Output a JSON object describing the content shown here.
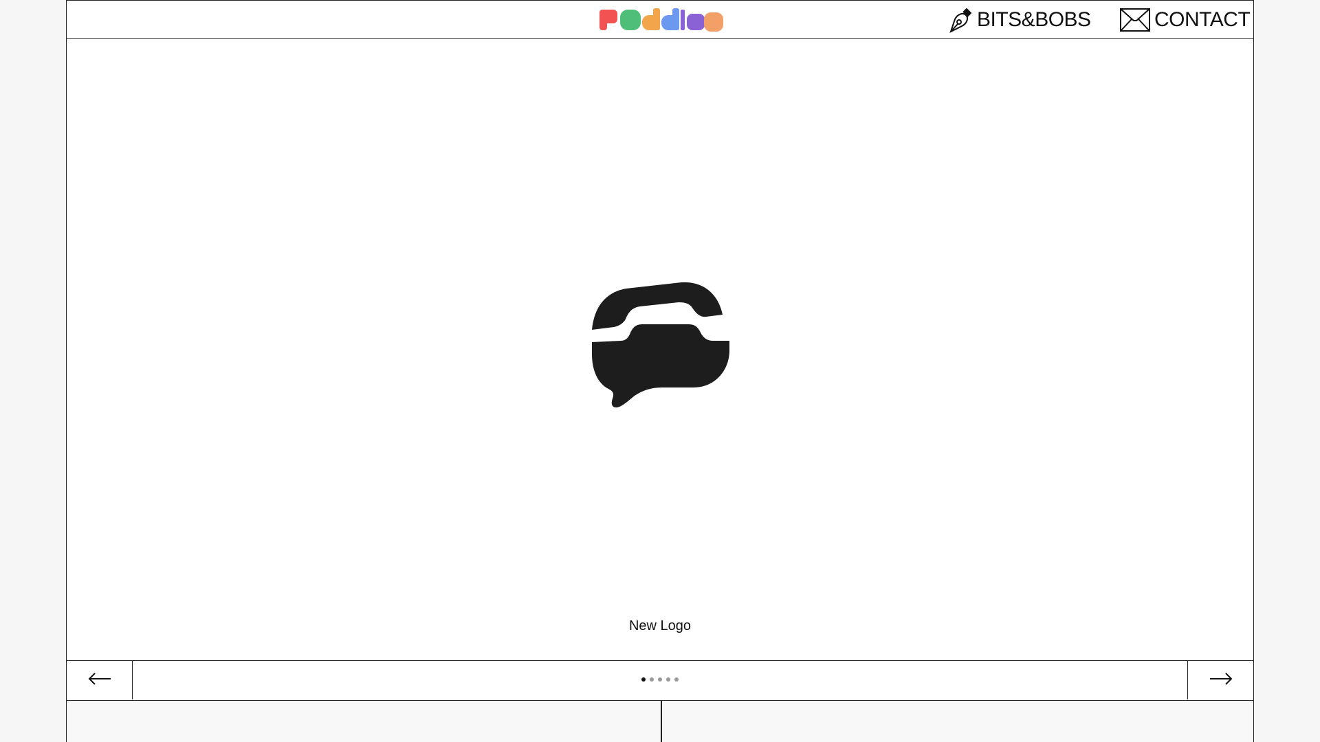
{
  "brand": {
    "logo_text": "pudding",
    "colors": [
      "#f25252",
      "#4fbe79",
      "#f2a54b",
      "#6d98f0",
      "#8b61d6",
      "#f2a068"
    ]
  },
  "nav": {
    "bits_label": "BITS&BOBS",
    "contact_label": "CONTACT",
    "bits_icon": "pen-nib-icon",
    "contact_icon": "envelope-icon"
  },
  "slide": {
    "caption": "New Logo",
    "logo_icon": "phone-chat-logo-icon",
    "index": 1,
    "total": 5
  },
  "controls": {
    "prev_icon": "arrow-left-icon",
    "next_icon": "arrow-right-icon"
  }
}
